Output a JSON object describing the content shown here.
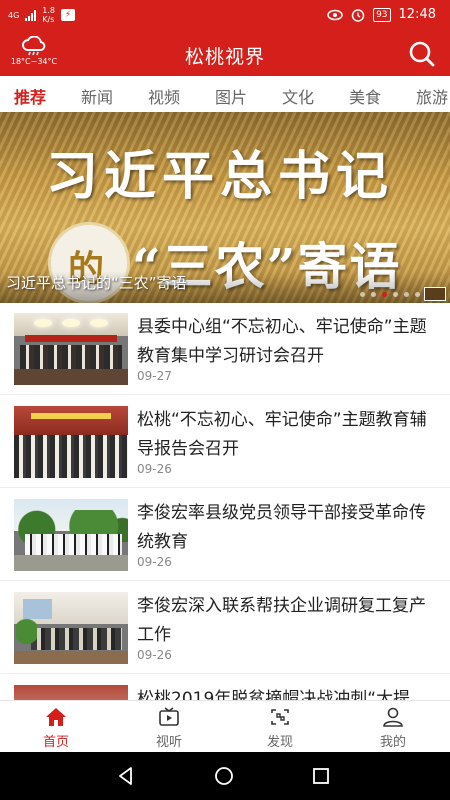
{
  "status_bar": {
    "network": "4G",
    "speed_value": "1.8",
    "speed_unit": "K/s",
    "battery": "93",
    "time": "12:48",
    "icons": [
      "signal-icon",
      "data-saver-icon",
      "eye-icon",
      "alarm-icon",
      "battery-icon"
    ]
  },
  "header": {
    "weather_range": "18°C~34°C",
    "title": "松桃视界",
    "weather_icon": "cloud-rain-icon",
    "search_icon": "search-icon"
  },
  "tabs": [
    {
      "label": "推荐",
      "active": true
    },
    {
      "label": "新闻",
      "active": false
    },
    {
      "label": "视频",
      "active": false
    },
    {
      "label": "图片",
      "active": false
    },
    {
      "label": "文化",
      "active": false
    },
    {
      "label": "美食",
      "active": false
    },
    {
      "label": "旅游",
      "active": false
    }
  ],
  "banner": {
    "headline_line1": "习近平总书记",
    "headline_de": "的",
    "headline_line2": "“三农”寄语",
    "caption": "习近平总书记的“三农”寄语",
    "slide_count": 6,
    "active_slide": 3
  },
  "news": [
    {
      "title": "县委中心组“不忘初心、牢记使命”主题教育集中学习研讨会召开",
      "date": "09-27"
    },
    {
      "title": "松桃“不忘初心、牢记使命”主题教育辅导报告会召开",
      "date": "09-26"
    },
    {
      "title": "李俊宏率县级党员领导干部接受革命传统教育",
      "date": "09-26"
    },
    {
      "title": "李俊宏深入联系帮扶企业调研复工复产工作",
      "date": "09-26"
    },
    {
      "title": "松桃2019年脱贫摘帽决战冲刺“大提",
      "date": ""
    }
  ],
  "bottom_nav": [
    {
      "label": "首页",
      "icon": "home-icon",
      "active": true
    },
    {
      "label": "视听",
      "icon": "tv-icon",
      "active": false
    },
    {
      "label": "发现",
      "icon": "discover-icon",
      "active": false
    },
    {
      "label": "我的",
      "icon": "person-icon",
      "active": false
    }
  ],
  "colors": {
    "brand": "#d41f1b",
    "text": "#222222",
    "muted": "#888888"
  }
}
